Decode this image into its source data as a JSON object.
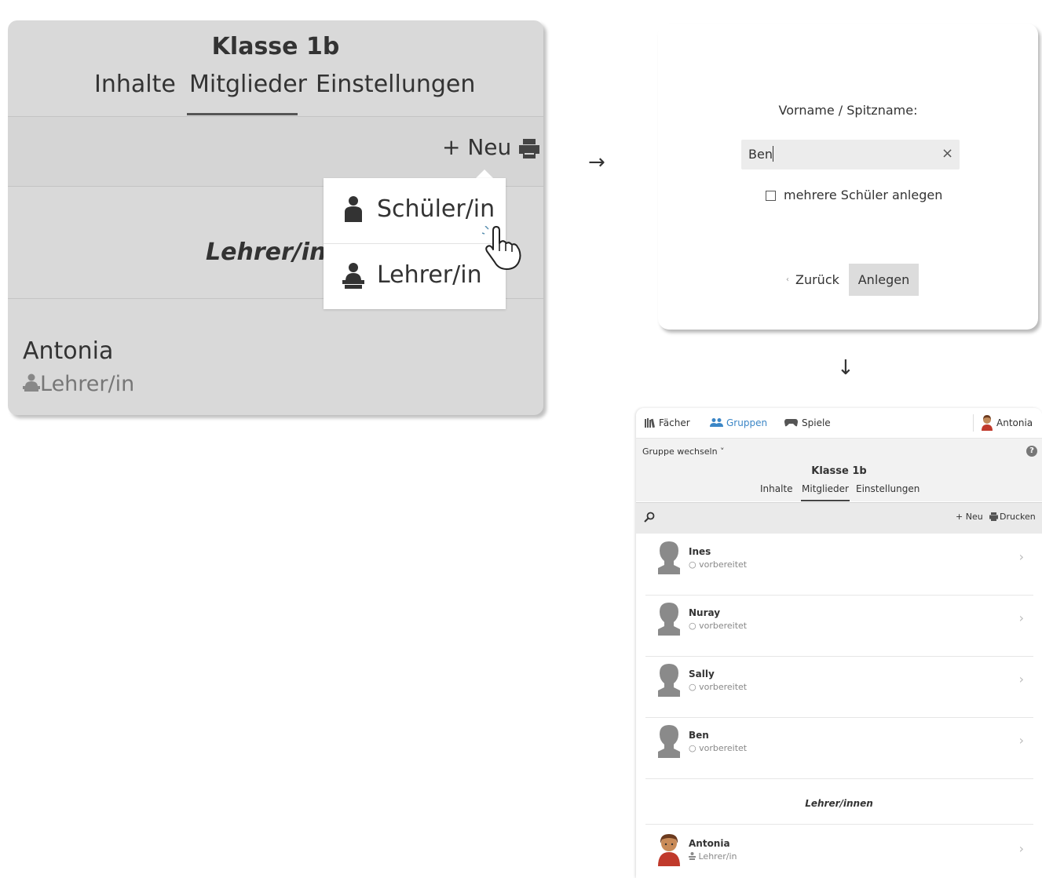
{
  "zoomed_view": {
    "group_title": "Klasse 1b",
    "tabs": [
      "Inhalte",
      "Mitglieder",
      "Einstellungen"
    ],
    "active_tab": "Mitglieder",
    "new_button": "+ Neu",
    "dropdown": {
      "items": [
        {
          "icon": "student-icon",
          "label": "Schüler/in"
        },
        {
          "icon": "teacher-icon",
          "label": "Lehrer/in"
        }
      ]
    },
    "section_heading_partial": "Lehrer/inn",
    "member": {
      "name": "Antonia",
      "role": "Lehrer/in"
    }
  },
  "arrows": {
    "right": "→",
    "down": "↓"
  },
  "dialog": {
    "field_label": "Vorname / Spitzname:",
    "input_value": "Ben",
    "clear_icon": "×",
    "checkbox_label": "mehrere Schüler anlegen",
    "back_button": "Zurück",
    "create_button": "Anlegen"
  },
  "app": {
    "nav": {
      "subjects": "Fächer",
      "groups": "Gruppen",
      "games": "Spiele",
      "user": "Antonia",
      "active_color": "#3b86c6"
    },
    "switch_group": "Gruppe wechseln ˅",
    "help_icon": "?",
    "group_title": "Klasse 1b",
    "tabs": [
      "Inhalte",
      "Mitglieder",
      "Einstellungen"
    ],
    "active_tab": "Mitglieder",
    "toolbar": {
      "new": "+ Neu",
      "print": "Drucken"
    },
    "students": [
      {
        "name": "Ines",
        "status": "○ vorbereitet"
      },
      {
        "name": "Nuray",
        "status": "○ vorbereitet"
      },
      {
        "name": "Sally",
        "status": "○ vorbereitet"
      },
      {
        "name": "Ben",
        "status": "○ vorbereitet"
      }
    ],
    "teachers_heading": "Lehrer/innen",
    "teachers": [
      {
        "name": "Antonia",
        "role": "Lehrer/in"
      }
    ]
  }
}
